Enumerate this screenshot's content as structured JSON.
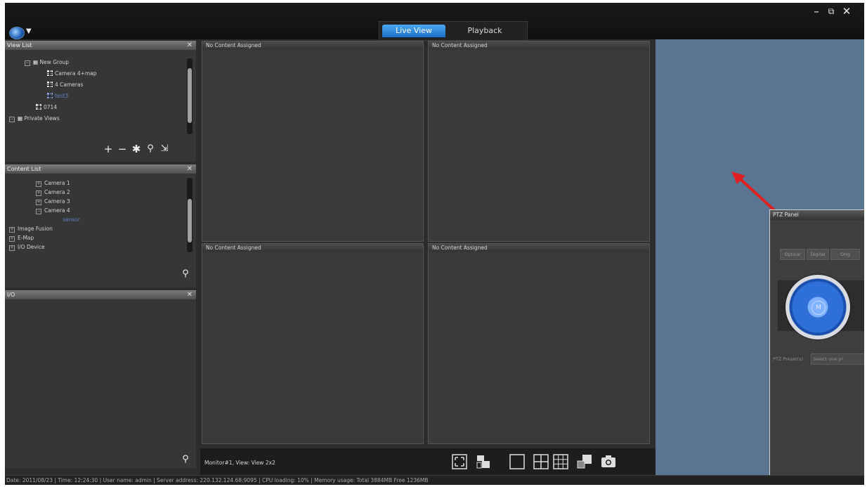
{
  "header": {
    "tabs": [
      {
        "label": "Live View",
        "active": true
      },
      {
        "label": "Playback",
        "active": false
      }
    ],
    "window_controls": [
      "minimize-icon",
      "restore-icon",
      "close-icon"
    ]
  },
  "view_list": {
    "title": "View List",
    "items": [
      {
        "label": "New Group"
      },
      {
        "label": "Camera 4+map"
      },
      {
        "label": "4 Cameras"
      },
      {
        "label": "test3",
        "selected": true
      },
      {
        "label": "0714"
      },
      {
        "label": "Private Views"
      }
    ],
    "tools": [
      "add-icon",
      "remove-icon",
      "settings-icon",
      "search-icon",
      "export-icon"
    ]
  },
  "content_list": {
    "title": "Content List",
    "items": [
      {
        "label": "Camera 1"
      },
      {
        "label": "Camera 2"
      },
      {
        "label": "Camera 3"
      },
      {
        "label": "Camera 4"
      },
      {
        "label": "sensor",
        "selected": true
      },
      {
        "label": "Image Fusion"
      },
      {
        "label": "E-Map"
      },
      {
        "label": "I/O Device"
      }
    ]
  },
  "io_panel": {
    "title": "I/O"
  },
  "grid": {
    "cells": [
      {
        "label": "No Content Assigned"
      },
      {
        "label": "No Content Assigned"
      },
      {
        "label": "No Content Assigned"
      },
      {
        "label": "No Content Assigned"
      }
    ]
  },
  "ptz_panel": {
    "title": "PTZ Panel",
    "tabs": [
      "Optical",
      "Digital",
      "Orig"
    ],
    "center_label": "M",
    "preset_label": "PTZ Preset(s)",
    "preset_placeholder": "Select one pr"
  },
  "bottombar": {
    "monitor_label": "Monitor#1, View: View 2x2"
  },
  "statusbar": {
    "text": "Date: 2011/08/23  |  Time: 12:24:30  |  User name: admin  |  Server address: 220.132.124.68:9095  |  CPU loading: 10%  |  Memory usage: Total 3884MB  Free 1236MB"
  },
  "colors": {
    "accent": "#2f84e0",
    "desktop_blue": "#5a7592",
    "arrow": "#e02020"
  }
}
